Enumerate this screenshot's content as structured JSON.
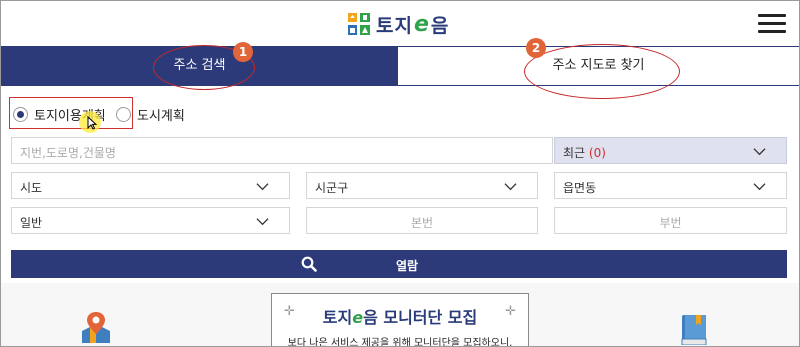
{
  "header": {
    "logo_text_before": "토지",
    "logo_text_e": "e",
    "logo_text_after": "음",
    "menu_icon": "hamburger-icon"
  },
  "tabs": [
    {
      "label": "주소 검색",
      "active": true
    },
    {
      "label": "주소 지도로 찾기",
      "active": false
    }
  ],
  "annotations": {
    "badge1": "1",
    "badge2": "2",
    "color": "#c62828",
    "badge_color": "#e2653a"
  },
  "radios": [
    {
      "label": "토지이용계획",
      "checked": true
    },
    {
      "label": "도시계획",
      "checked": false
    }
  ],
  "search": {
    "address_placeholder": "지번,도로명,건물명",
    "recent_label": "최근",
    "recent_count": "(0)"
  },
  "selects": {
    "sido": "시도",
    "sigungu": "시군구",
    "eupmyeondong": "읍면동",
    "type": "일반"
  },
  "lot": {
    "main_placeholder": "본번",
    "sub_placeholder": "부번"
  },
  "search_button": {
    "label": "열람",
    "icon": "search-icon"
  },
  "banner": {
    "title_before": "토지",
    "title_e": "e",
    "title_after": "음 모니터단 모집",
    "sparkle": "✛",
    "description": "보다 나은 서비스 제공을 위해 모니터단을 모집하오니,"
  },
  "colors": {
    "primary": "#2d3a7a",
    "accent_green": "#2fa24b",
    "red": "#d32f2f"
  }
}
